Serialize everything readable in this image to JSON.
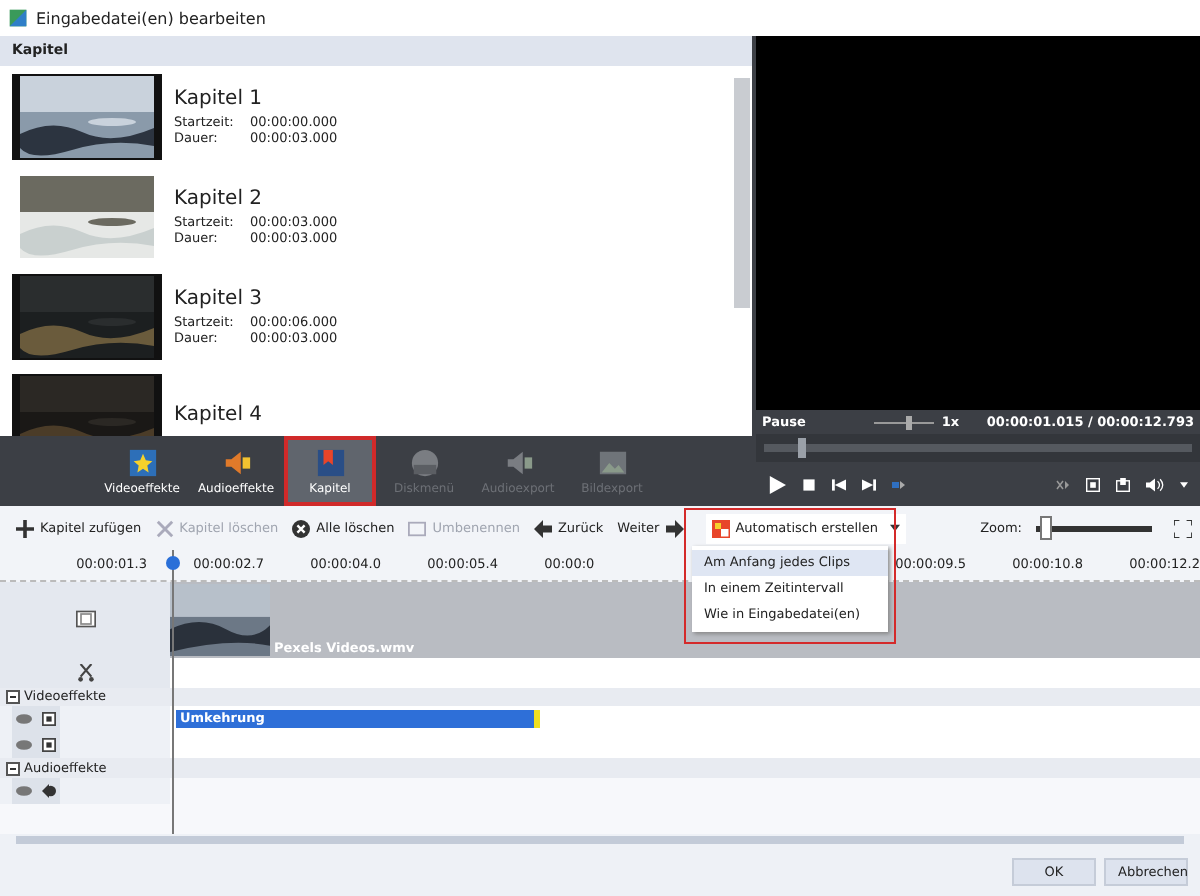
{
  "window": {
    "title": "Eingabedatei(en) bearbeiten"
  },
  "chapter_panel": {
    "header": "Kapitel",
    "chapters": [
      {
        "title": "Kapitel 1",
        "start_label": "Startzeit:",
        "start": "00:00:00.000",
        "duration_label": "Dauer:",
        "duration": "00:00:03.000"
      },
      {
        "title": "Kapitel 2",
        "start_label": "Startzeit:",
        "start": "00:00:03.000",
        "duration_label": "Dauer:",
        "duration": "00:00:03.000"
      },
      {
        "title": "Kapitel 3",
        "start_label": "Startzeit:",
        "start": "00:00:06.000",
        "duration_label": "Dauer:",
        "duration": "00:00:03.000"
      },
      {
        "title": "Kapitel 4"
      }
    ]
  },
  "player": {
    "state": "Pause",
    "speed_slider": {
      "level": 0.6
    },
    "speed": "1x",
    "time": "00:00:01.015 / 00:00:12.793",
    "position": {
      "level": 0.08
    }
  },
  "tabs": [
    {
      "label": "Videoeffekte",
      "kind": "video",
      "selected": false,
      "disabled": false
    },
    {
      "label": "Audioeffekte",
      "kind": "audio",
      "selected": false,
      "disabled": false
    },
    {
      "label": "Kapitel",
      "kind": "chapter",
      "selected": true,
      "disabled": false
    },
    {
      "label": "Diskmenü",
      "kind": "disc",
      "selected": false,
      "disabled": true
    },
    {
      "label": "Audioexport",
      "kind": "audioexport",
      "selected": false,
      "disabled": true
    },
    {
      "label": "Bildexport",
      "kind": "imageexport",
      "selected": false,
      "disabled": true
    }
  ],
  "toolbar": [
    {
      "label": "Kapitel zufügen",
      "kind": "add",
      "disabled": false
    },
    {
      "label": "Kapitel löschen",
      "kind": "delete",
      "disabled": true
    },
    {
      "label": "Alle löschen",
      "kind": "clear",
      "disabled": false
    },
    {
      "label": "Umbenennen",
      "kind": "rename",
      "disabled": true
    },
    {
      "label": "Zurück",
      "kind": "back",
      "disabled": false
    },
    {
      "label": "Weiter",
      "kind": "next",
      "disabled": false
    }
  ],
  "dropdown": {
    "label": "Automatisch erstellen",
    "items": [
      {
        "label": "Am Anfang jedes Clips",
        "selected": true
      },
      {
        "label": "In einem Zeitintervall",
        "selected": false
      },
      {
        "label": "Wie in Eingabedatei(en)",
        "selected": false
      }
    ]
  },
  "zoom": {
    "label": "Zoom:",
    "level": 0.03
  },
  "ruler": [
    "00:00:01.3",
    "00:00:02.7",
    "00:00:04.0",
    "00:00:05.4",
    "00:00:0",
    "00:00:09.5",
    "00:00:10.8",
    "00:00:12.2"
  ],
  "timeline": {
    "clip": "Pexels Videos.wmv",
    "video_effects": {
      "header": "Videoeffekte",
      "effect": "Umkehrung"
    },
    "audio_effects": {
      "header": "Audioeffekte"
    }
  },
  "buttons": [
    "OK",
    "Abbrechen"
  ]
}
